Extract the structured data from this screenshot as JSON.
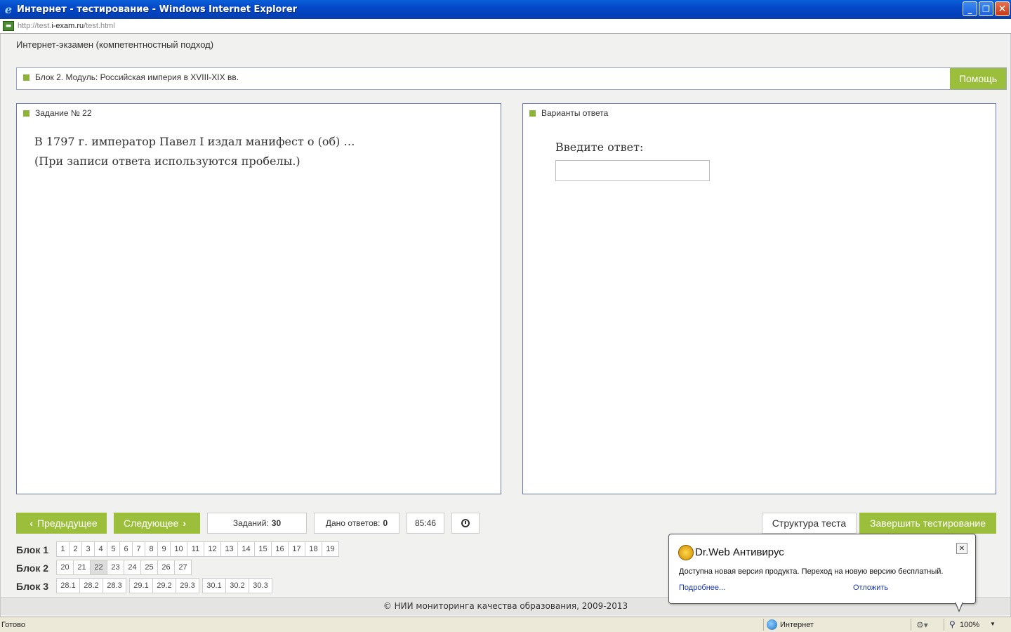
{
  "window": {
    "title": "Интернет - тестирование - Windows Internet Explorer",
    "minimize": "_",
    "restore": "❐",
    "close": "✕"
  },
  "address": {
    "prefix": "http://test.",
    "domain": "i-exam.ru",
    "path": "/test.html"
  },
  "page": {
    "exam_title": "Интернет-экзамен (компетентностный подход)",
    "block_label": "Блок 2. Модуль: Российская империя в XVIII-XIX вв.",
    "help": "Помощь"
  },
  "task": {
    "header": "Задание № 22",
    "line1": "В 1797 г. император Павел I издал манифест о (об) …",
    "line2": "(При записи ответа используются пробелы.)"
  },
  "answer": {
    "header": "Варианты ответа",
    "label": "Введите ответ:",
    "value": ""
  },
  "controls": {
    "prev": "Предыдущее",
    "next": "Следующее",
    "tasks_label": "Заданий:",
    "tasks_value": "30",
    "answered_label": "Дано ответов:",
    "answered_value": "0",
    "timer": "85:46",
    "structure": "Структура теста",
    "finish": "Завершить тестирование"
  },
  "navigation": {
    "current": "22",
    "blocks": [
      {
        "label": "Блок 1",
        "items": [
          "1",
          "2",
          "3",
          "4",
          "5",
          "6",
          "7",
          "8",
          "9",
          "10",
          "11",
          "12",
          "13",
          "14",
          "15",
          "16",
          "17",
          "18",
          "19"
        ]
      },
      {
        "label": "Блок 2",
        "items": [
          "20",
          "21",
          "22",
          "23",
          "24",
          "25",
          "26",
          "27"
        ]
      },
      {
        "label": "Блок 3",
        "items": [
          "28.1",
          "28.2",
          "28.3",
          "|",
          "29.1",
          "29.2",
          "29.3",
          "|",
          "30.1",
          "30.2",
          "30.3"
        ]
      }
    ]
  },
  "footer": "© НИИ мониторинга качества образования, 2009-2013",
  "status": {
    "ready": "Готово",
    "zone": "Интернет",
    "zoom": "100%"
  },
  "drweb": {
    "title": "Dr.Web Антивирус",
    "message": "Доступна новая версия продукта. Переход на новую версию бесплатный.",
    "more": "Подробнее...",
    "later": "Отложить",
    "close": "✕"
  }
}
